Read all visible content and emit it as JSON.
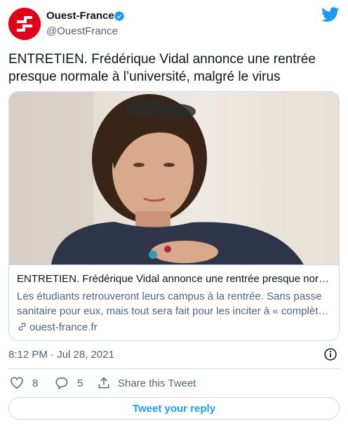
{
  "author": {
    "name": "Ouest-France",
    "handle": "@OuestFrance"
  },
  "tweet": {
    "text": "ENTRETIEN. Frédérique Vidal annonce une rentrée presque normale à l’université, malgré le virus"
  },
  "card": {
    "title": "ENTRETIEN. Frédérique Vidal annonce une rentrée presque normale à l’université, malgré le virus",
    "description_line1": "Les étudiants retrouveront leurs campus à la rentrée. Sans passe",
    "description_line2": "sanitaire pour eux, mais tout sera fait pour les inciter à « complètement se vacciner »",
    "link": "ouest-france.fr"
  },
  "meta": {
    "timestamp": "8:12 PM · Jul 28, 2021"
  },
  "actions": {
    "likes": "8",
    "replies": "5",
    "share_label": "Share this Tweet",
    "reply_button": "Tweet your reply"
  },
  "colors": {
    "brand_red": "#e2001a",
    "twitter_blue": "#1d9bf0",
    "secondary_text": "#536471",
    "border": "#cfd9de"
  },
  "icons": [
    "ouest-france-logo",
    "verified-icon",
    "twitter-bird-icon",
    "link-icon",
    "info-icon",
    "heart-icon",
    "reply-icon",
    "share-icon"
  ]
}
